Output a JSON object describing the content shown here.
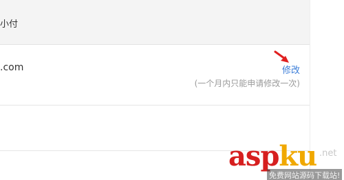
{
  "header": {
    "label": "小付"
  },
  "account": {
    "email_visible": ".com",
    "modify_label": "修改",
    "modify_note": "(一个月内只能申请修改一次)"
  },
  "watermark": {
    "part1": "asp",
    "part2": "ku",
    "net": ".net",
    "sub": "免费网站源码下载站!"
  },
  "colors": {
    "link": "#3b7dd8",
    "arrow": "#e02020",
    "header_bg": "#f4f4f4"
  },
  "icons": {
    "arrow": "red-arrow-icon"
  }
}
